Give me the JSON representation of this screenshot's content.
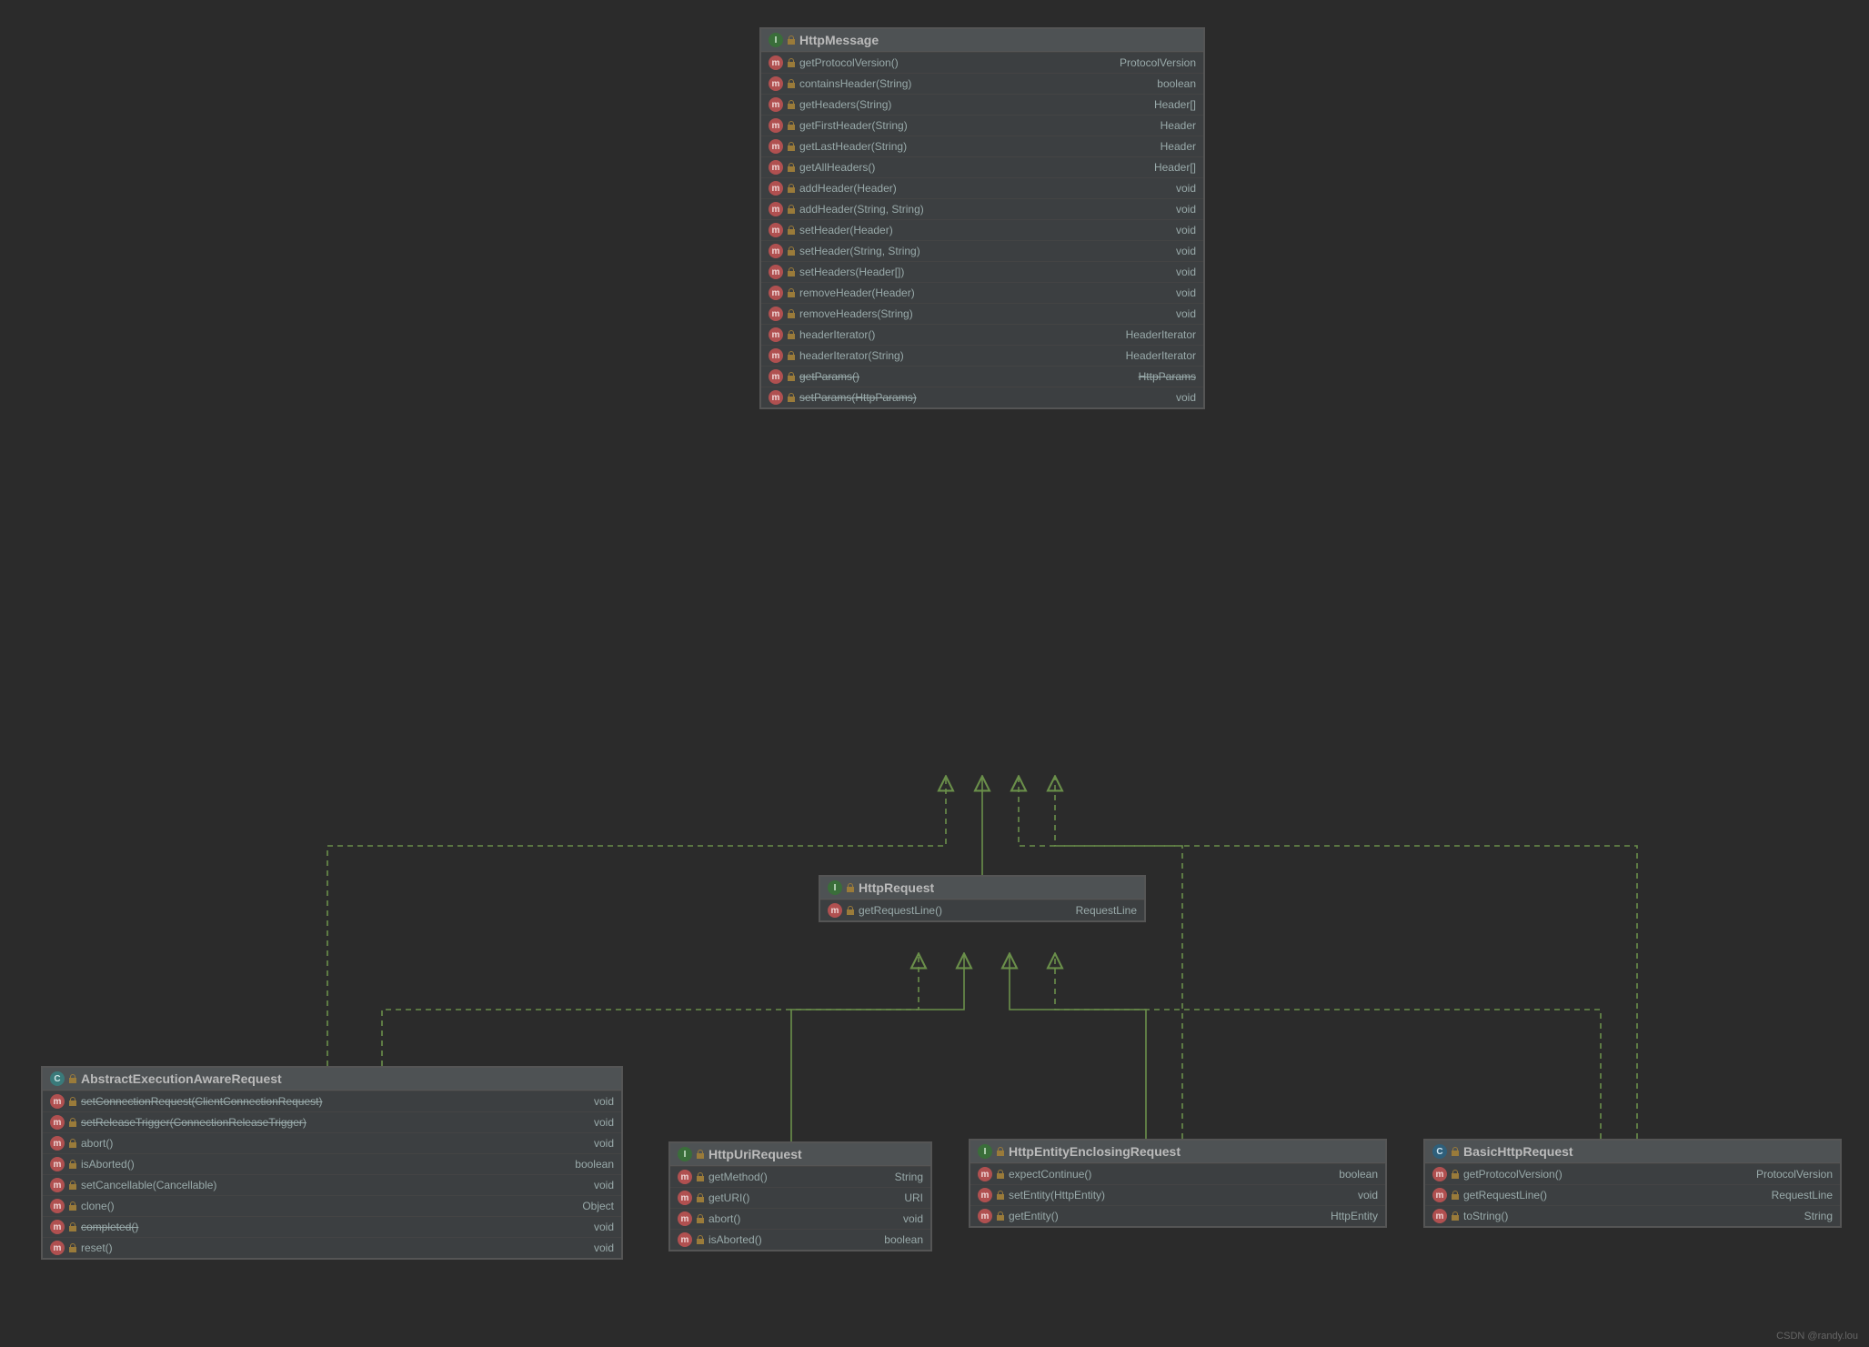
{
  "watermark": "CSDN @randy.lou",
  "classes": {
    "httpMessage": {
      "kind": "interface",
      "name": "HttpMessage",
      "members": [
        {
          "sig": "getProtocolVersion()",
          "ret": "ProtocolVersion"
        },
        {
          "sig": "containsHeader(String)",
          "ret": "boolean"
        },
        {
          "sig": "getHeaders(String)",
          "ret": "Header[]"
        },
        {
          "sig": "getFirstHeader(String)",
          "ret": "Header"
        },
        {
          "sig": "getLastHeader(String)",
          "ret": "Header"
        },
        {
          "sig": "getAllHeaders()",
          "ret": "Header[]"
        },
        {
          "sig": "addHeader(Header)",
          "ret": "void"
        },
        {
          "sig": "addHeader(String, String)",
          "ret": "void"
        },
        {
          "sig": "setHeader(Header)",
          "ret": "void"
        },
        {
          "sig": "setHeader(String, String)",
          "ret": "void"
        },
        {
          "sig": "setHeaders(Header[])",
          "ret": "void"
        },
        {
          "sig": "removeHeader(Header)",
          "ret": "void"
        },
        {
          "sig": "removeHeaders(String)",
          "ret": "void"
        },
        {
          "sig": "headerIterator()",
          "ret": "HeaderIterator"
        },
        {
          "sig": "headerIterator(String)",
          "ret": "HeaderIterator"
        },
        {
          "sig": "getParams()",
          "ret": "HttpParams",
          "deprecated": true,
          "retStrike": true
        },
        {
          "sig": "setParams(HttpParams)",
          "ret": "void",
          "deprecated": true
        }
      ]
    },
    "httpRequest": {
      "kind": "interface",
      "name": "HttpRequest",
      "members": [
        {
          "sig": "getRequestLine()",
          "ret": "RequestLine"
        }
      ]
    },
    "abstractExecutionAwareRequest": {
      "kind": "abstract-class",
      "name": "AbstractExecutionAwareRequest",
      "members": [
        {
          "sig": "setConnectionRequest(ClientConnectionRequest)",
          "ret": "void",
          "deprecated": true,
          "iconKind": "m"
        },
        {
          "sig": "setReleaseTrigger(ConnectionReleaseTrigger)",
          "ret": "void",
          "deprecated": true,
          "iconKind": "m"
        },
        {
          "sig": "abort()",
          "ret": "void",
          "iconKind": "m"
        },
        {
          "sig": "isAborted()",
          "ret": "boolean",
          "iconKind": "m"
        },
        {
          "sig": "setCancellable(Cancellable)",
          "ret": "void",
          "iconKind": "m"
        },
        {
          "sig": "clone()",
          "ret": "Object",
          "iconKind": "m"
        },
        {
          "sig": "completed()",
          "ret": "void",
          "deprecated": true,
          "iconKind": "m"
        },
        {
          "sig": "reset()",
          "ret": "void",
          "iconKind": "m"
        }
      ]
    },
    "httpUriRequest": {
      "kind": "interface",
      "name": "HttpUriRequest",
      "members": [
        {
          "sig": "getMethod()",
          "ret": "String"
        },
        {
          "sig": "getURI()",
          "ret": "URI"
        },
        {
          "sig": "abort()",
          "ret": "void"
        },
        {
          "sig": "isAborted()",
          "ret": "boolean"
        }
      ]
    },
    "httpEntityEnclosingRequest": {
      "kind": "interface",
      "name": "HttpEntityEnclosingRequest",
      "members": [
        {
          "sig": "expectContinue()",
          "ret": "boolean"
        },
        {
          "sig": "setEntity(HttpEntity)",
          "ret": "void"
        },
        {
          "sig": "getEntity()",
          "ret": "HttpEntity"
        }
      ]
    },
    "basicHttpRequest": {
      "kind": "class",
      "name": "BasicHttpRequest",
      "members": [
        {
          "sig": "getProtocolVersion()",
          "ret": "ProtocolVersion",
          "iconKind": "m"
        },
        {
          "sig": "getRequestLine()",
          "ret": "RequestLine",
          "iconKind": "m"
        },
        {
          "sig": "toString()",
          "ret": "String",
          "iconKind": "m"
        }
      ]
    }
  },
  "icons": {
    "i": "I",
    "c": "C",
    "m": "m",
    "cc": "C"
  }
}
